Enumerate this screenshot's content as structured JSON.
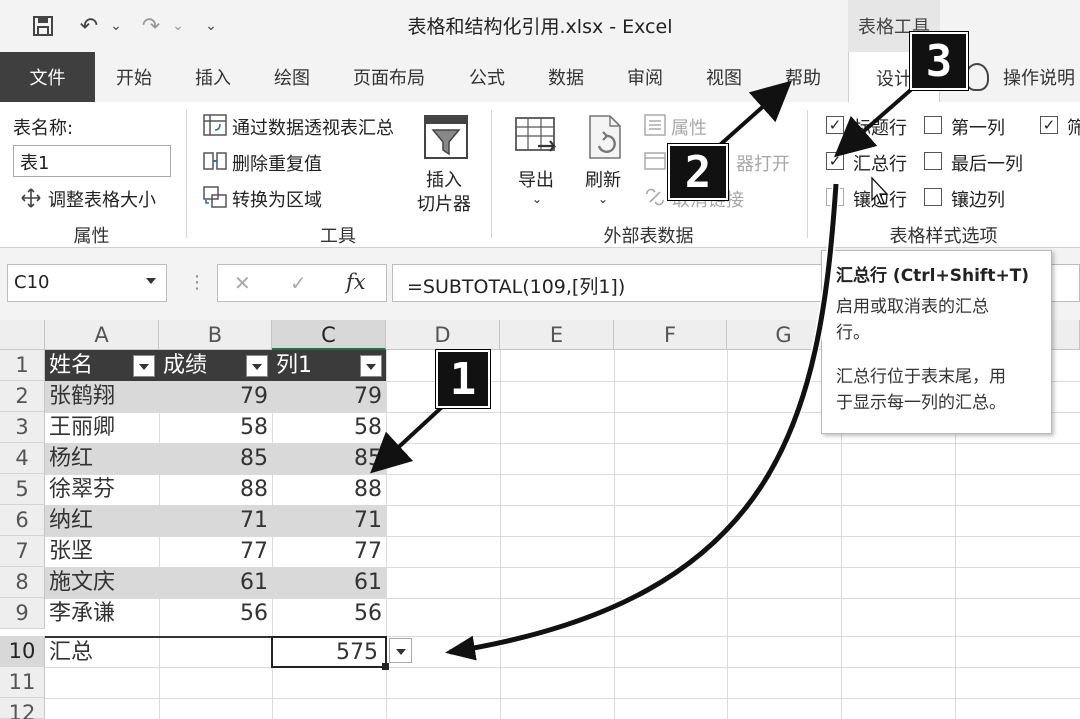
{
  "titlebar": {
    "title": "表格和结构化引用.xlsx  -  Excel",
    "tool_group": "表格工具",
    "qat": {
      "save": "💾",
      "undo": "↶",
      "undo_dd": "⌄",
      "redo": "↷",
      "redo_dd": "⌄",
      "customize": "⌄"
    }
  },
  "tabs": [
    "文件",
    "开始",
    "插入",
    "绘图",
    "页面布局",
    "公式",
    "数据",
    "审阅",
    "视图",
    "帮助",
    "设计"
  ],
  "tell_me": "操作说明",
  "ribbon": {
    "properties": {
      "table_name_label": "表名称:",
      "table_name_value": "表1",
      "resize": "调整表格大小",
      "group": "属性"
    },
    "tools": {
      "pivot": "通过数据透视表汇总",
      "remove_dup": "删除重复值",
      "convert": "转换为区域",
      "slicer_line1": "插入",
      "slicer_line2": "切片器",
      "group": "工具"
    },
    "external": {
      "export": "导出",
      "refresh": "刷新",
      "properties": "属性",
      "open_browser": "器打开",
      "unlink": "取消链接",
      "group": "外部表数据"
    },
    "style_options": {
      "header_row": "标题行",
      "first_column": "第一列",
      "filter_button": "筛",
      "total_row": "汇总行",
      "last_column": "最后一列",
      "banded_rows": "镶边行",
      "banded_columns": "镶边列",
      "group": "表格样式选项"
    }
  },
  "formula_bar": {
    "name_box": "C10",
    "cancel": "✕",
    "enter": "✓",
    "fx": "fx",
    "formula": "=SUBTOTAL(109,[列1])"
  },
  "sheet": {
    "columns": [
      "A",
      "B",
      "C",
      "D",
      "E",
      "F",
      "G"
    ],
    "rows": [
      "1",
      "2",
      "3",
      "4",
      "5",
      "6",
      "7",
      "8",
      "9",
      "10",
      "11",
      "12"
    ],
    "headers": [
      "姓名",
      "成绩",
      "列1"
    ],
    "data": [
      [
        "张鹤翔",
        "79",
        "79"
      ],
      [
        "王丽卿",
        "58",
        "58"
      ],
      [
        "杨红",
        "85",
        "85"
      ],
      [
        "徐翠芬",
        "88",
        "88"
      ],
      [
        "纳红",
        "71",
        "71"
      ],
      [
        "张坚",
        "77",
        "77"
      ],
      [
        "施文庆",
        "61",
        "61"
      ],
      [
        "李承谦",
        "56",
        "56"
      ]
    ],
    "total_label": "汇总",
    "total_value": "575"
  },
  "tooltip": {
    "title": "汇总行 (Ctrl+Shift+T)",
    "line1": "启用或取消表的汇总",
    "line2": "行。",
    "line3": "汇总行位于表末尾，用",
    "line4": "于显示每一列的汇总。"
  },
  "callouts": [
    "1",
    "2",
    "3"
  ],
  "colors": {
    "file_tab": "#3f3f3f",
    "table_header": "#3b3b3b",
    "band": "#d9d9d9",
    "excel_green": "#217346"
  }
}
